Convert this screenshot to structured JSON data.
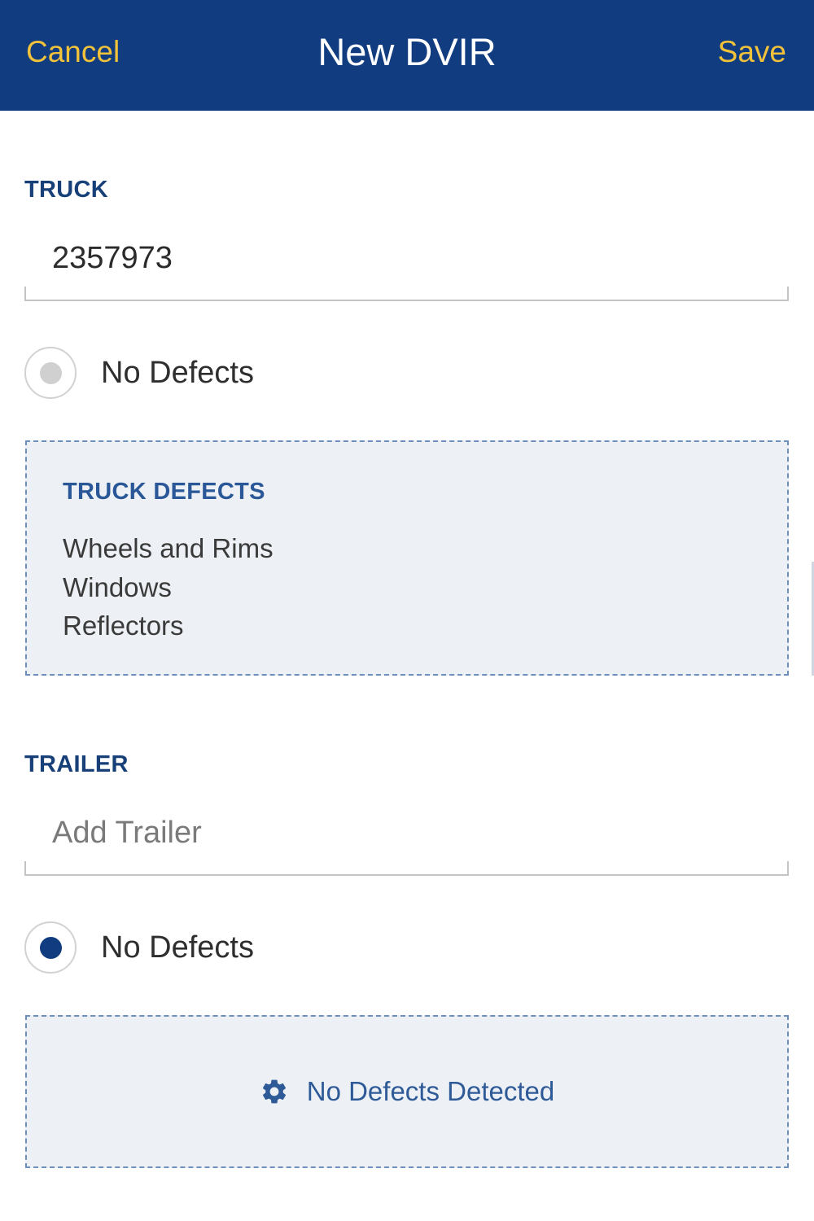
{
  "header": {
    "cancel_label": "Cancel",
    "title": "New DVIR",
    "save_label": "Save"
  },
  "truck": {
    "section_label": "TRUCK",
    "value": "2357973",
    "no_defects_label": "No Defects",
    "no_defects_checked": false,
    "defects_title": "TRUCK DEFECTS",
    "defects": [
      "Wheels and Rims",
      "Windows",
      "Reflectors"
    ]
  },
  "trailer": {
    "section_label": "TRAILER",
    "placeholder": "Add Trailer",
    "no_defects_label": "No Defects",
    "no_defects_checked": true,
    "empty_state_icon": "gear-icon",
    "empty_state_text": "No Defects Detected"
  },
  "colors": {
    "header_bg": "#113c80",
    "header_action": "#f2c23a",
    "section_label": "#173f78",
    "radio_selected": "#113c80",
    "box_bg": "#edf0f4",
    "box_border": "#6d8fbd"
  }
}
